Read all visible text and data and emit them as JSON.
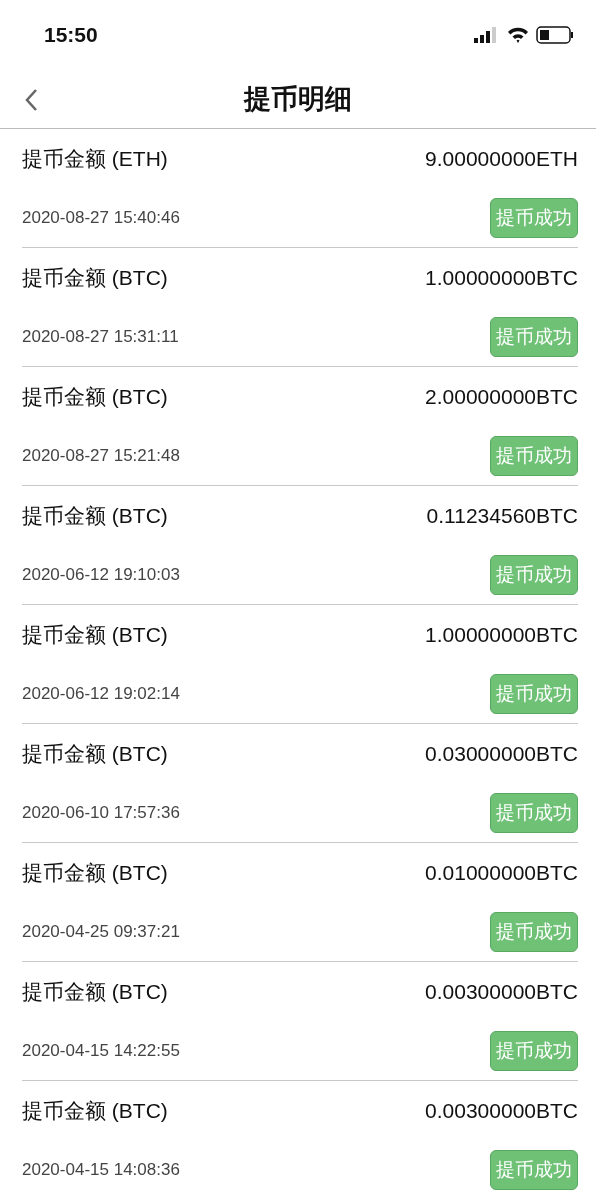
{
  "status_bar": {
    "time": "15:50"
  },
  "header": {
    "title": "提币明细"
  },
  "records": [
    {
      "label": "提币金额 (ETH)",
      "amount": "9.00000000ETH",
      "time": "2020-08-27 15:40:46",
      "status": "提币成功"
    },
    {
      "label": "提币金额 (BTC)",
      "amount": "1.00000000BTC",
      "time": "2020-08-27 15:31:11",
      "status": "提币成功"
    },
    {
      "label": "提币金额 (BTC)",
      "amount": "2.00000000BTC",
      "time": "2020-08-27 15:21:48",
      "status": "提币成功"
    },
    {
      "label": "提币金额 (BTC)",
      "amount": "0.11234560BTC",
      "time": "2020-06-12 19:10:03",
      "status": "提币成功"
    },
    {
      "label": "提币金额 (BTC)",
      "amount": "1.00000000BTC",
      "time": "2020-06-12 19:02:14",
      "status": "提币成功"
    },
    {
      "label": "提币金额 (BTC)",
      "amount": "0.03000000BTC",
      "time": "2020-06-10 17:57:36",
      "status": "提币成功"
    },
    {
      "label": "提币金额 (BTC)",
      "amount": "0.01000000BTC",
      "time": "2020-04-25 09:37:21",
      "status": "提币成功"
    },
    {
      "label": "提币金额 (BTC)",
      "amount": "0.00300000BTC",
      "time": "2020-04-15 14:22:55",
      "status": "提币成功"
    },
    {
      "label": "提币金额 (BTC)",
      "amount": "0.00300000BTC",
      "time": "2020-04-15 14:08:36",
      "status": "提币成功"
    }
  ]
}
